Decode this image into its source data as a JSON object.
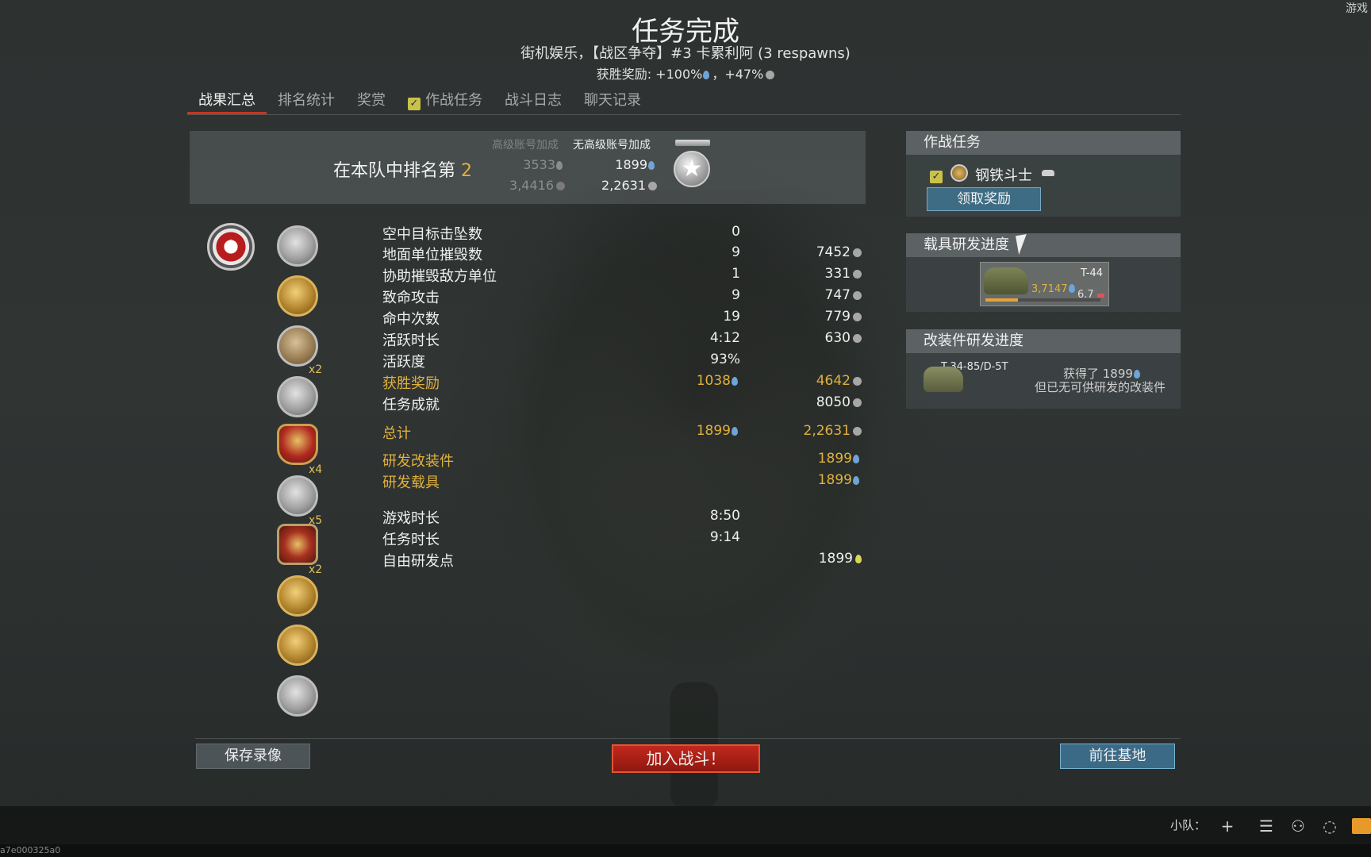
{
  "corner": "游戏",
  "title": "任务完成",
  "subtitle": "街机娱乐，【战区争夺】#3 卡累利阿 (3 respawns)",
  "reward": {
    "label": "获胜奖励: ",
    "rp": "+100%",
    "sep": "，",
    "sl": "+47%"
  },
  "tabs": [
    {
      "label": "战果汇总"
    },
    {
      "label": "排名统计"
    },
    {
      "label": "奖赏"
    },
    {
      "label": "作战任务"
    },
    {
      "label": "战斗日志"
    },
    {
      "label": "聊天记录"
    }
  ],
  "rank": {
    "prefix": "在本队中排名第 ",
    "number": "2",
    "premium_header": "高级账号加成",
    "nopremium_header": "无高级账号加成",
    "premium_rp": "3533",
    "premium_sl": "3,4416",
    "base_rp": "1899",
    "base_sl": "2,2631"
  },
  "awards": {
    "multipliers": [
      "x2",
      "x4",
      "x5",
      "x2"
    ]
  },
  "stats": [
    {
      "label": "空中目标击坠数",
      "mid": "0",
      "right": ""
    },
    {
      "label": "地面单位摧毁数",
      "mid": "9",
      "right": "7452"
    },
    {
      "label": "协助摧毁敌方单位",
      "mid": "1",
      "right": "331"
    },
    {
      "label": "致命攻击",
      "mid": "9",
      "right": "747"
    },
    {
      "label": "命中次数",
      "mid": "19",
      "right": "779"
    },
    {
      "label": "活跃时长",
      "mid": "4:12",
      "right": "630"
    },
    {
      "label": "活跃度",
      "mid": "93%",
      "right": ""
    },
    {
      "label": "获胜奖励",
      "mid": "1038",
      "right": "4642"
    },
    {
      "label": "任务成就",
      "mid": "",
      "right": "8050"
    },
    {
      "label": "总计",
      "mid": "1899",
      "right": "2,2631"
    },
    {
      "label": "研发改装件",
      "mid": "",
      "right": "1899"
    },
    {
      "label": "研发载具",
      "mid": "",
      "right": "1899"
    },
    {
      "label": "游戏时长",
      "mid": "8:50",
      "right": ""
    },
    {
      "label": "任务时长",
      "mid": "9:14",
      "right": ""
    },
    {
      "label": "自由研发点",
      "mid": "",
      "right": "1899"
    }
  ],
  "side": {
    "tasks_title": "作战任务",
    "task_name": "钢铁斗士",
    "claim_label": "领取奖励",
    "vehicle_title": "载具研发进度",
    "vehicle_name": "T-44",
    "vehicle_rp": "3,7147",
    "vehicle_br": "6.7",
    "vehicle_progress": 0.28,
    "mods_title": "改装件研发进度",
    "mod_vehicle": "T-34-85/D-5T",
    "mod_line1": "获得了 1899",
    "mod_line2": "但已无可供研发的改装件"
  },
  "buttons": {
    "save": "保存录像",
    "join": "加入战斗！",
    "base": "前往基地"
  },
  "taskbar": {
    "squad": "小队："
  },
  "hash": "a7e000325a0",
  "colors": {
    "accent_red": "#c8351f",
    "gold": "#e0b13c",
    "rp_blue": "#6ea4d8",
    "button_blue": "#3b6a86"
  }
}
